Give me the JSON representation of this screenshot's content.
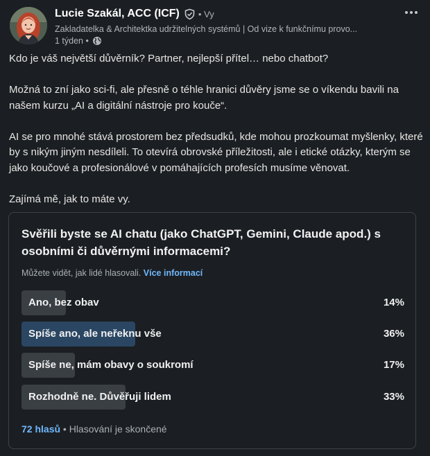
{
  "author": {
    "name": "Lucie Szakál, ACC (ICF)",
    "degree": "• Vy",
    "headline": "Zakladatelka & Architektka udržitelných systémů | Od vize k funkčnímu provo...",
    "time": "1 týden •"
  },
  "post": {
    "paragraphs": [
      "Kdo je váš největší důvěrník? Partner, nejlepší přítel… nebo chatbot?",
      "Možná to zní jako sci-fi, ale přesně o téhle hranici důvěry jsme se o víkendu bavili na našem kurzu „AI a digitální nástroje pro kouče“.",
      "AI se pro mnohé stává prostorem bez předsudků, kde mohou prozkoumat myšlenky, které by s nikým jiným nesdíleli. To otevírá obrovské příležitosti, ale i etické otázky, kterým se jako koučové a profesionálové v pomáhajících profesích musíme věnovat.",
      "Zajímá mě, jak to máte vy."
    ]
  },
  "poll": {
    "question": "Svěřili byste se AI chatu (jako ChatGPT, Gemini, Claude apod.) s osobními či důvěrnými informacemi?",
    "visibility_text": "Můžete vidět, jak lidé hlasovali.",
    "more_info_label": "Více informací",
    "options": [
      {
        "label": "Ano, bez obav",
        "percent_text": "14%",
        "percent": 14,
        "selected": false
      },
      {
        "label": "Spíše ano, ale neřeknu vše",
        "percent_text": "36%",
        "percent": 36,
        "selected": true
      },
      {
        "label": "Spíše ne, mám obavy o soukromí",
        "percent_text": "17%",
        "percent": 17,
        "selected": false
      },
      {
        "label": "Rozhodně ne. Důvěřuji lidem",
        "percent_text": "33%",
        "percent": 33,
        "selected": false
      }
    ],
    "votes_label": "72 hlasů",
    "status_text": "• Hlasování je skončené"
  },
  "icons": {
    "verified": "shield-check-icon",
    "visibility": "globe-icon",
    "more": "more-horizontal-icon"
  },
  "colors": {
    "background": "#1b1f23",
    "link": "#71b7fb",
    "selected_bar": "#2a4663",
    "bar": "#3a3f44"
  }
}
